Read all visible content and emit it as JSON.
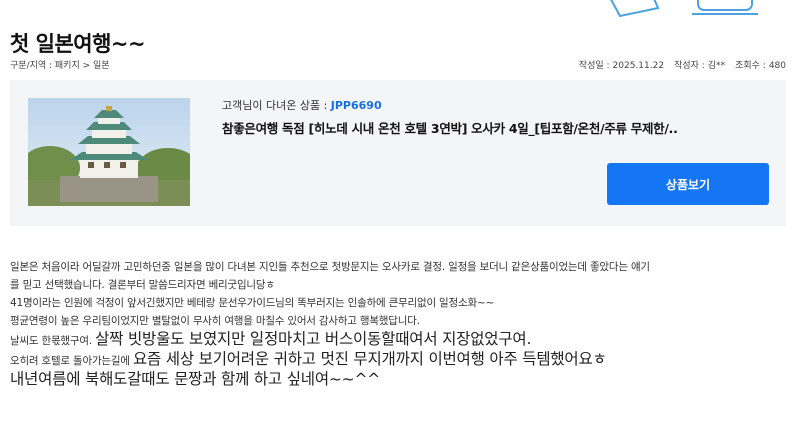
{
  "post": {
    "title": "첫 일본여행~~",
    "breadcrumb": "구분/지역 : 패키지 > 일본",
    "date_label": "작성일 :",
    "date": "2025.11.22",
    "author_label": "작성자 :",
    "author": "김**",
    "views_label": "조회수 :",
    "views": "480"
  },
  "product": {
    "code_label": "고객님이 다녀온 상품 :",
    "code": "JPP6690",
    "name": "참좋은여행 독점 [히노데 시내 온천 호텔 3연박] 오사카 4일_[팁포함/온천/주류 무제한/..",
    "button_label": "상품보기"
  },
  "review": {
    "line1": "일본은 처음이라 어딜갈까 고민하던중 일본을 많이 다녀본 지인들 추천으로 첫방문지는 오사카로 결정. 일정을 보더니 같은상품이었는데 좋았다는 얘기",
    "line2": "를 믿고 선택했습니다. 결론부터 말씀드리자면 베리굿입니당ㅎ",
    "line3": "41명이라는 인원에 걱정이 앞서긴했지만 베테랑 문선우가이드님의 똑부러지는 인솔하에 큰무리없이 일정소화~~",
    "line4": "평균연령이 높은 우리팀이었지만 별탈없이 무사히 여행을 마칠수 있어서 감사하고 행복했답니다.",
    "line5a": "날씨도 한몫했구여.",
    "line5b": "살짝 빗방울도 보였지만 일정마치고 버스이동할때여서 지장없었구여.",
    "line6a": "오히려 호텔로 돌아가는길에",
    "line6b": "요즘 세상 보기어려운 귀하고 멋진 무지개까지 이번여행 아주 득템했어요ㅎ",
    "line7": "내년여름에 북해도갈때도 문짱과 함께 하고 싶네여~~^^"
  },
  "colors": {
    "accent": "#1476f2",
    "product_code": "#1a6fe0",
    "card_bg": "#f4f5f7"
  }
}
